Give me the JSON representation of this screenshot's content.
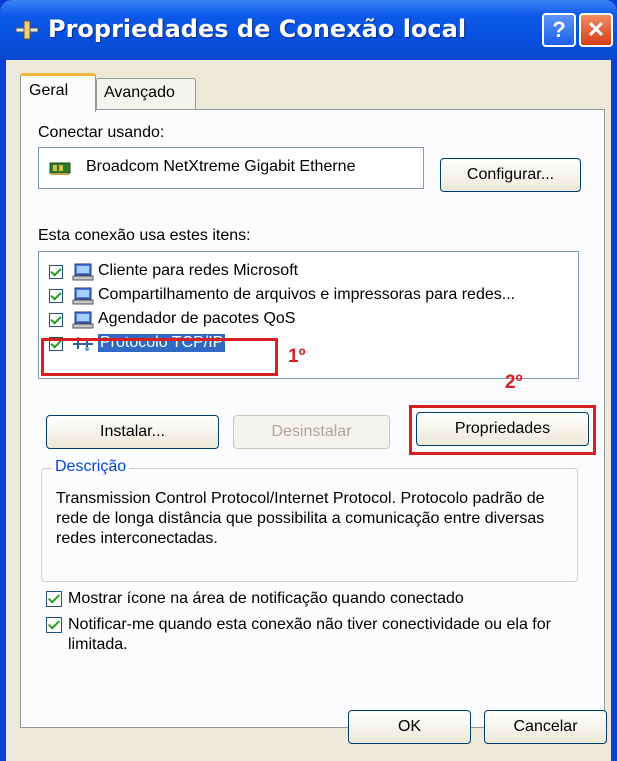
{
  "window": {
    "title": "Propriedades de Conexão local",
    "help_label": "?",
    "close_label": "✕"
  },
  "tabs": [
    {
      "label": "Geral",
      "active": true
    },
    {
      "label": "Avançado",
      "active": false
    }
  ],
  "connect_using": {
    "label": "Conectar usando:",
    "adapter": "Broadcom NetXtreme Gigabit Etherne",
    "configure_label": "Configurar..."
  },
  "items_section": {
    "label": "Esta conexão usa estes itens:",
    "items": [
      {
        "label": "Cliente para redes Microsoft",
        "checked": true,
        "icon": "network-client-icon"
      },
      {
        "label": "Compartilhamento de arquivos e impressoras para redes...",
        "checked": true,
        "icon": "file-printer-sharing-icon"
      },
      {
        "label": "Agendador de pacotes QoS",
        "checked": true,
        "icon": "qos-scheduler-icon"
      },
      {
        "label": "Protocolo TCP/IP",
        "checked": true,
        "selected": true,
        "icon": "protocol-icon"
      }
    ]
  },
  "buttons": {
    "install": "Instalar...",
    "uninstall": "Desinstalar",
    "properties": "Propriedades",
    "ok": "OK",
    "cancel": "Cancelar"
  },
  "annotations": {
    "first": "1º",
    "second": "2º",
    "color": "#d91f1f"
  },
  "description": {
    "title": "Descrição",
    "text": "Transmission Control Protocol/Internet Protocol. Protocolo padrão de rede de longa distância que possibilita a comunicação entre diversas redes interconectadas."
  },
  "options": {
    "show_icon": {
      "label": "Mostrar ícone na área de notificação quando conectado",
      "checked": true
    },
    "notify": {
      "label": "Notificar-me quando esta conexão não tiver conectividade ou ela for limitada.",
      "checked": true
    }
  }
}
